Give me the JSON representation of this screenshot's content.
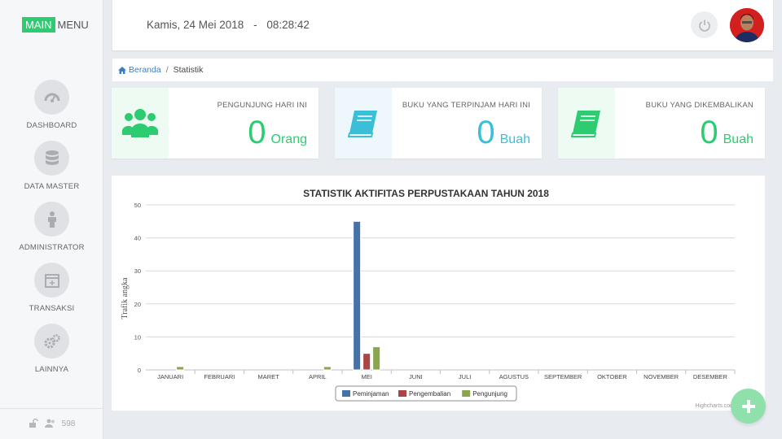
{
  "brand": {
    "main": "MAIN",
    "menu": "MENU"
  },
  "sidebar": {
    "items": [
      {
        "label": "DASHBOARD",
        "icon": "dashboard-icon"
      },
      {
        "label": "DATA MASTER",
        "icon": "database-icon"
      },
      {
        "label": "ADMINISTRATOR",
        "icon": "user-icon"
      },
      {
        "label": "TRANSAKSI",
        "icon": "calendar-plus-icon"
      },
      {
        "label": "LAINNYA",
        "icon": "gears-icon"
      }
    ],
    "footer_count": "598"
  },
  "header": {
    "date": "Kamis, 24 Mei 2018",
    "separator": "-",
    "time": "08:28:42"
  },
  "breadcrumb": {
    "home": "Beranda",
    "separator": "/",
    "current": "Statistik"
  },
  "cards": [
    {
      "title": "PENGUNJUNG HARI INI",
      "value": "0",
      "unit": "Orang",
      "color": "#2ecc71",
      "icon": "users-icon"
    },
    {
      "title": "BUKU YANG TERPINJAM HARI INI",
      "value": "0",
      "unit": "Buah",
      "color": "#3bbfd8",
      "icon": "book-icon"
    },
    {
      "title": "BUKU YANG DIKEMBALIKAN",
      "value": "0",
      "unit": "Buah",
      "color": "#2ecc71",
      "icon": "book-icon"
    }
  ],
  "chart_data": {
    "type": "bar",
    "title": "STATISTIK AKTIFITAS PERPUSTAKAAN TAHUN 2018",
    "ylabel": "Trafik angka",
    "xlabel": "",
    "ylim": [
      0,
      50
    ],
    "yticks": [
      0,
      10,
      20,
      30,
      40,
      50
    ],
    "categories": [
      "JANUARI",
      "FEBRUARI",
      "MARET",
      "APRIL",
      "MEI",
      "JUNI",
      "JULI",
      "AGUSTUS",
      "SEPTEMBER",
      "OKTOBER",
      "NOVEMBER",
      "DESEMBER"
    ],
    "series": [
      {
        "name": "Peminjaman",
        "color": "#4572a7",
        "values": [
          0,
          0,
          0,
          0,
          45,
          0,
          0,
          0,
          0,
          0,
          0,
          0
        ]
      },
      {
        "name": "Pengembalian",
        "color": "#aa4643",
        "values": [
          0,
          0,
          0,
          0,
          5,
          0,
          0,
          0,
          0,
          0,
          0,
          0
        ]
      },
      {
        "name": "Pengunjung",
        "color": "#89a54e",
        "values": [
          1,
          0,
          0,
          1,
          7,
          0,
          0,
          0,
          0,
          0,
          0,
          0
        ]
      }
    ],
    "grid": true,
    "legend": "bottom-center",
    "credits": "Highcharts.com"
  }
}
